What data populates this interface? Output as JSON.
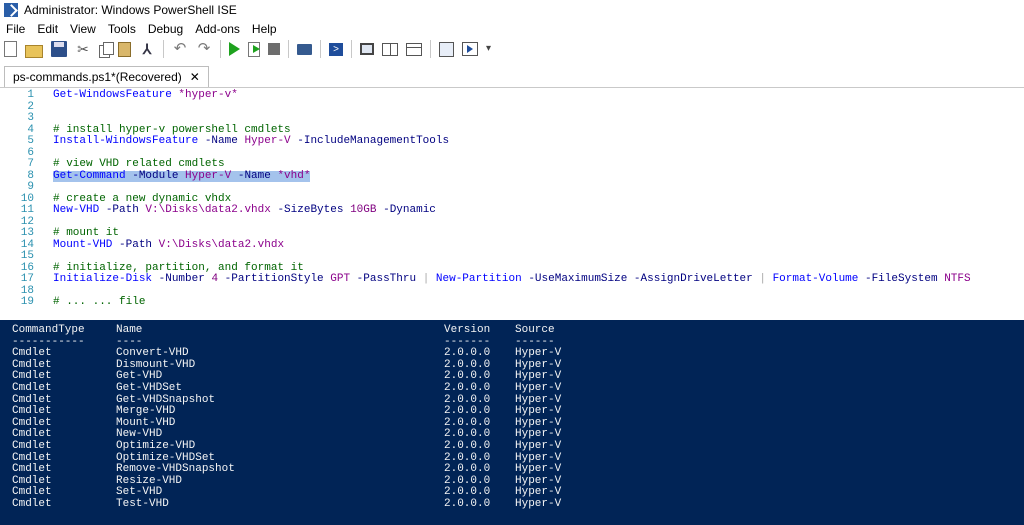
{
  "window": {
    "title": "Administrator: Windows PowerShell ISE"
  },
  "menu": [
    "File",
    "Edit",
    "View",
    "Tools",
    "Debug",
    "Add-ons",
    "Help"
  ],
  "toolbar_icons": [
    "new-icon",
    "open-icon",
    "save-icon",
    "cut-icon",
    "copy-icon",
    "paste-icon",
    "clear-console-icon",
    "undo-icon",
    "redo-icon",
    "run-script-icon",
    "run-selection-icon",
    "stop-icon",
    "new-remote-tab-icon",
    "powershell-icon",
    "layout-script-top-icon",
    "layout-script-right-icon",
    "layout-script-maximized-icon",
    "show-script-pane-icon",
    "show-command-addon-icon",
    "more-icon"
  ],
  "tab": {
    "label": "ps-commands.ps1*(Recovered)",
    "close": "✕"
  },
  "editor": {
    "lines": [
      {
        "n": "1",
        "segments": [
          [
            "cmd",
            "Get-WindowsFeature "
          ],
          [
            "str",
            "*hyper-v*"
          ]
        ]
      },
      {
        "n": "2",
        "segments": []
      },
      {
        "n": "3",
        "segments": []
      },
      {
        "n": "4",
        "segments": [
          [
            "cm",
            "# install hyper-v powershell cmdlets"
          ]
        ]
      },
      {
        "n": "5",
        "segments": [
          [
            "cmd",
            "Install-WindowsFeature "
          ],
          [
            "prm",
            "-Name "
          ],
          [
            "str",
            "Hyper-V "
          ],
          [
            "prm",
            "-IncludeManagementTools"
          ]
        ]
      },
      {
        "n": "6",
        "segments": []
      },
      {
        "n": "7",
        "segments": [
          [
            "cm",
            "# view VHD related cmdlets"
          ]
        ]
      },
      {
        "n": "8",
        "selected": true,
        "segments": [
          [
            "cmd",
            "Get-Command "
          ],
          [
            "prm",
            "-Module "
          ],
          [
            "str",
            "Hyper-V "
          ],
          [
            "prm",
            "-Name "
          ],
          [
            "str",
            "*vhd*"
          ]
        ]
      },
      {
        "n": "9",
        "segments": []
      },
      {
        "n": "10",
        "segments": [
          [
            "cm",
            "# create a new dynamic vhdx"
          ]
        ]
      },
      {
        "n": "11",
        "segments": [
          [
            "cmd",
            "New-VHD "
          ],
          [
            "prm",
            "-Path "
          ],
          [
            "str",
            "V:\\Disks\\data2.vhdx "
          ],
          [
            "prm",
            "-SizeBytes "
          ],
          [
            "num",
            "10GB "
          ],
          [
            "prm",
            "-Dynamic"
          ]
        ]
      },
      {
        "n": "12",
        "segments": []
      },
      {
        "n": "13",
        "segments": [
          [
            "cm",
            "# mount it"
          ]
        ]
      },
      {
        "n": "14",
        "segments": [
          [
            "cmd",
            "Mount-VHD "
          ],
          [
            "prm",
            "-Path "
          ],
          [
            "str",
            "V:\\Disks\\data2.vhdx"
          ]
        ]
      },
      {
        "n": "15",
        "segments": []
      },
      {
        "n": "16",
        "segments": [
          [
            "cm",
            "# initialize, partition, and format it"
          ]
        ]
      },
      {
        "n": "17",
        "segments": [
          [
            "cmd",
            "Initialize-Disk "
          ],
          [
            "prm",
            "-Number "
          ],
          [
            "num",
            "4 "
          ],
          [
            "prm",
            "-PartitionStyle "
          ],
          [
            "str",
            "GPT "
          ],
          [
            "prm",
            "-PassThru "
          ],
          [
            "op",
            "| "
          ],
          [
            "cmd",
            "New-Partition "
          ],
          [
            "prm",
            "-UseMaximumSize -AssignDriveLetter "
          ],
          [
            "op",
            "| "
          ],
          [
            "cmd",
            "Format-Volume "
          ],
          [
            "prm",
            "-FileSystem "
          ],
          [
            "str",
            "NTFS"
          ]
        ]
      },
      {
        "n": "18",
        "segments": []
      },
      {
        "n": "19",
        "segments": [
          [
            "cm",
            "# ... ... file"
          ]
        ]
      }
    ]
  },
  "console": {
    "headers": [
      "CommandType",
      "Name",
      "Version",
      "Source"
    ],
    "underlines": [
      "-----------",
      "----",
      "-------",
      "------"
    ],
    "rows": [
      [
        "Cmdlet",
        "Convert-VHD",
        "2.0.0.0",
        "Hyper-V"
      ],
      [
        "Cmdlet",
        "Dismount-VHD",
        "2.0.0.0",
        "Hyper-V"
      ],
      [
        "Cmdlet",
        "Get-VHD",
        "2.0.0.0",
        "Hyper-V"
      ],
      [
        "Cmdlet",
        "Get-VHDSet",
        "2.0.0.0",
        "Hyper-V"
      ],
      [
        "Cmdlet",
        "Get-VHDSnapshot",
        "2.0.0.0",
        "Hyper-V"
      ],
      [
        "Cmdlet",
        "Merge-VHD",
        "2.0.0.0",
        "Hyper-V"
      ],
      [
        "Cmdlet",
        "Mount-VHD",
        "2.0.0.0",
        "Hyper-V"
      ],
      [
        "Cmdlet",
        "New-VHD",
        "2.0.0.0",
        "Hyper-V"
      ],
      [
        "Cmdlet",
        "Optimize-VHD",
        "2.0.0.0",
        "Hyper-V"
      ],
      [
        "Cmdlet",
        "Optimize-VHDSet",
        "2.0.0.0",
        "Hyper-V"
      ],
      [
        "Cmdlet",
        "Remove-VHDSnapshot",
        "2.0.0.0",
        "Hyper-V"
      ],
      [
        "Cmdlet",
        "Resize-VHD",
        "2.0.0.0",
        "Hyper-V"
      ],
      [
        "Cmdlet",
        "Set-VHD",
        "2.0.0.0",
        "Hyper-V"
      ],
      [
        "Cmdlet",
        "Test-VHD",
        "2.0.0.0",
        "Hyper-V"
      ]
    ]
  },
  "colors": {
    "console_bg": "#012456",
    "selection": "#a4c3ec",
    "comment": "#006400"
  }
}
